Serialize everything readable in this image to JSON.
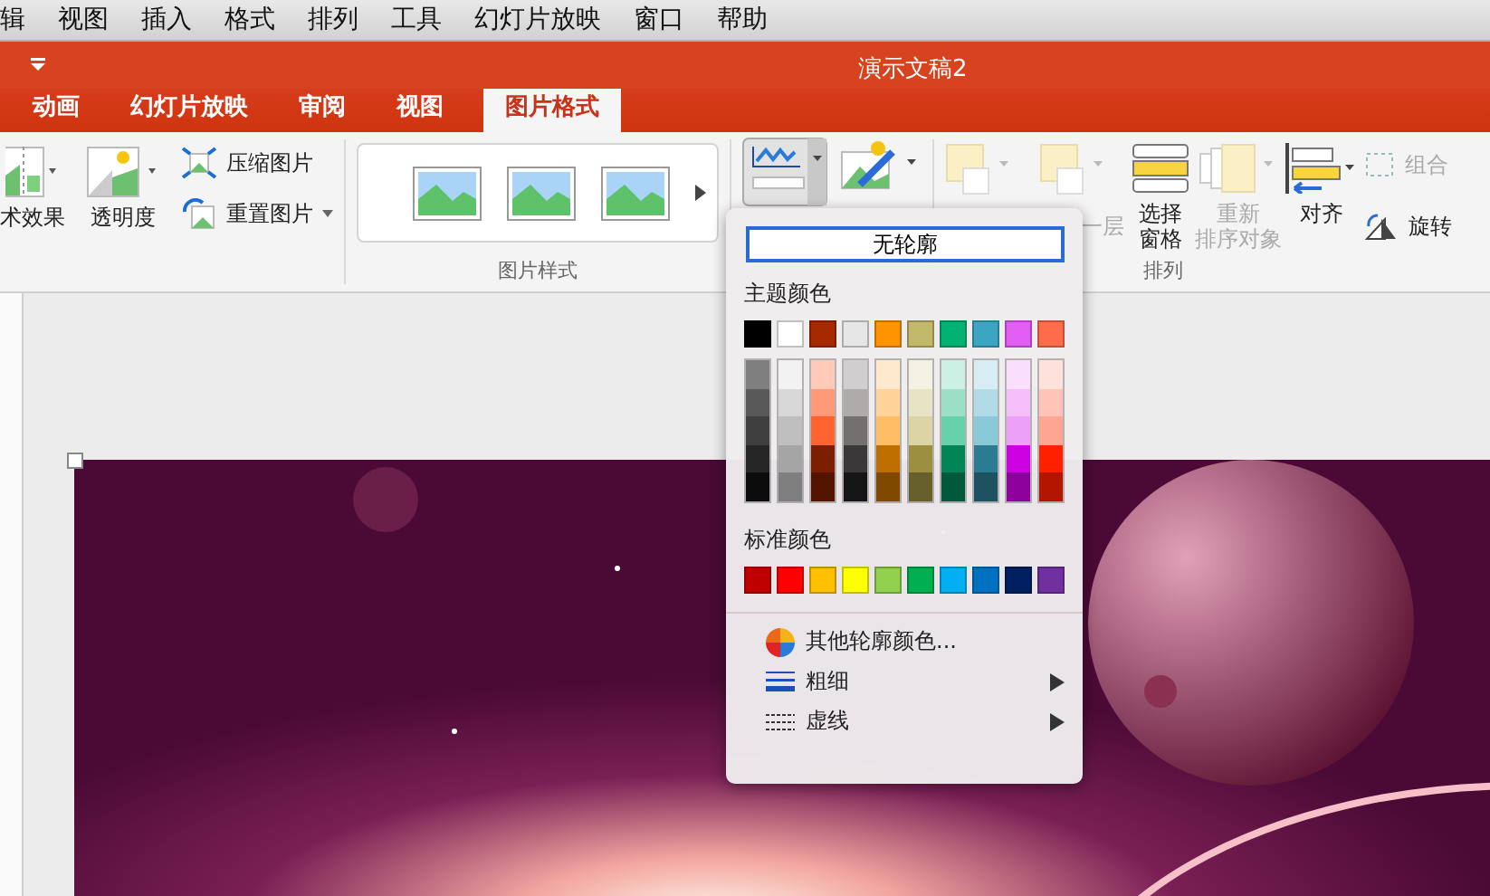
{
  "menu_bar": [
    "辑",
    "视图",
    "插入",
    "格式",
    "排列",
    "工具",
    "幻灯片放映",
    "窗口",
    "帮助"
  ],
  "window": {
    "title": "演示文稿2"
  },
  "tabs": [
    {
      "label": "动画",
      "selected": false
    },
    {
      "label": "幻灯片放映",
      "selected": false
    },
    {
      "label": "审阅",
      "selected": false
    },
    {
      "label": "视图",
      "selected": false
    },
    {
      "label": "图片格式",
      "selected": true
    }
  ],
  "ribbon": {
    "adjust": {
      "effects_label": "术效果",
      "transparency_label": "透明度",
      "compress_label": "压缩图片",
      "reset_label": "重置图片"
    },
    "styles": {
      "label": "图片样式"
    },
    "arrange": {
      "label": "排列",
      "items": [
        {
          "lines": [
            "一层"
          ],
          "disabled": true
        },
        {
          "lines": [
            "选择",
            "窗格"
          ],
          "disabled": false
        },
        {
          "lines": [
            "重新",
            "排序对象"
          ],
          "disabled": true
        },
        {
          "lines": [
            "对齐"
          ],
          "disabled": false
        }
      ],
      "group_label": "组合",
      "group_disabled": true,
      "rotate_label": "旋转"
    }
  },
  "outline_menu": {
    "no_outline": "无轮廓",
    "theme_title": "主题颜色",
    "theme_colors": [
      {
        "color": "#000000",
        "shades": [
          {
            "color": "#7f7f7f"
          },
          {
            "color": "#595959"
          },
          {
            "color": "#3f3f3f"
          },
          {
            "color": "#262626"
          },
          {
            "color": "#0c0c0c"
          }
        ]
      },
      {
        "color": "#ffffff",
        "shades": [
          {
            "color": "#f2f2f2"
          },
          {
            "color": "#d8d8d8"
          },
          {
            "color": "#bfbfbf"
          },
          {
            "color": "#a5a5a5"
          },
          {
            "color": "#7f7f7f"
          }
        ]
      },
      {
        "color": "#a52a00",
        "shades": [
          {
            "color": "#ffcbb8"
          },
          {
            "color": "#ff9a78"
          },
          {
            "color": "#ff6430"
          },
          {
            "color": "#7c1f00"
          },
          {
            "color": "#531500"
          }
        ]
      },
      {
        "color": "#e7e6e6",
        "shades": [
          {
            "color": "#d0cece"
          },
          {
            "color": "#afabab"
          },
          {
            "color": "#757070"
          },
          {
            "color": "#3a3838"
          },
          {
            "color": "#171616"
          }
        ]
      },
      {
        "color": "#ff9300",
        "shades": [
          {
            "color": "#ffe9cc"
          },
          {
            "color": "#ffd399"
          },
          {
            "color": "#ffbe66"
          },
          {
            "color": "#bf6e00"
          },
          {
            "color": "#7f4900"
          }
        ]
      },
      {
        "color": "#c3b96b",
        "shades": [
          {
            "color": "#f3f1e1"
          },
          {
            "color": "#e7e3c4"
          },
          {
            "color": "#dbd5a6"
          },
          {
            "color": "#9b9040"
          },
          {
            "color": "#67602a"
          }
        ]
      },
      {
        "color": "#00b274",
        "shades": [
          {
            "color": "#ccf0e3"
          },
          {
            "color": "#99e0c7"
          },
          {
            "color": "#66d1ab"
          },
          {
            "color": "#008557"
          },
          {
            "color": "#00593a"
          }
        ]
      },
      {
        "color": "#3ba5c2",
        "shades": [
          {
            "color": "#d8edf3"
          },
          {
            "color": "#b0dbe7"
          },
          {
            "color": "#89c9da"
          },
          {
            "color": "#2b7c92"
          },
          {
            "color": "#1d5261"
          }
        ]
      },
      {
        "color": "#e25ef2",
        "shades": [
          {
            "color": "#f9dffc"
          },
          {
            "color": "#f3bef9"
          },
          {
            "color": "#eda0f7"
          },
          {
            "color": "#cc00e0"
          },
          {
            "color": "#8c009c"
          }
        ]
      },
      {
        "color": "#ff6c4c",
        "shades": [
          {
            "color": "#ffe1db"
          },
          {
            "color": "#ffc4b7"
          },
          {
            "color": "#ffa693"
          },
          {
            "color": "#ff2000"
          },
          {
            "color": "#b31500"
          }
        ]
      }
    ],
    "standard_title": "标准颜色",
    "standard_colors": [
      {
        "color": "#c00000"
      },
      {
        "color": "#ff0000"
      },
      {
        "color": "#ffc000"
      },
      {
        "color": "#ffff00"
      },
      {
        "color": "#92d050"
      },
      {
        "color": "#00b050"
      },
      {
        "color": "#00b0f0"
      },
      {
        "color": "#0070c0"
      },
      {
        "color": "#002060"
      },
      {
        "color": "#7030a0"
      }
    ],
    "items": [
      {
        "kind": "more",
        "label": "其他轮廓颜色...",
        "submenu": false
      },
      {
        "kind": "weight",
        "label": "粗细",
        "submenu": true
      },
      {
        "kind": "dash",
        "label": "虚线",
        "submenu": true
      }
    ]
  }
}
